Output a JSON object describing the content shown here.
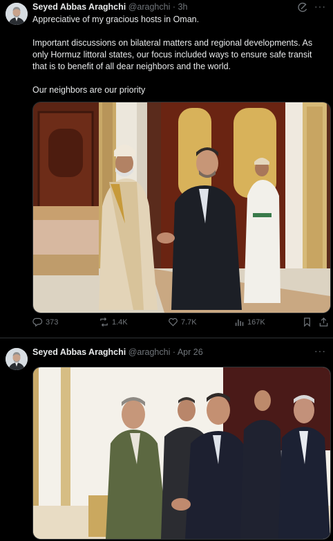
{
  "tweet1": {
    "author_name": "Seyed Abbas Araghchi",
    "handle": "@araghchi",
    "separator": "·",
    "time": "3h",
    "paragraphs": [
      "Appreciative of my gracious hosts in Oman.",
      "Important discussions on bilateral matters and regional developments. As only Hormuz littoral states, our focus included ways to ensure safe transit that is to benefit of all dear neighbors and the world.",
      "Our neighbors are our priority"
    ],
    "actions": {
      "replies": "373",
      "reposts": "1.4K",
      "likes": "7.7K",
      "views": "167K"
    }
  },
  "tweet2": {
    "author_name": "Seyed Abbas Araghchi",
    "handle": "@araghchi",
    "separator": "·",
    "time": "Apr 26"
  },
  "icons": {
    "grok": "grok-icon",
    "more": "more-icon",
    "reply": "reply-icon",
    "repost": "repost-icon",
    "like": "like-icon",
    "views": "views-icon",
    "bookmark": "bookmark-icon",
    "share": "share-icon"
  },
  "more_glyph": "···"
}
